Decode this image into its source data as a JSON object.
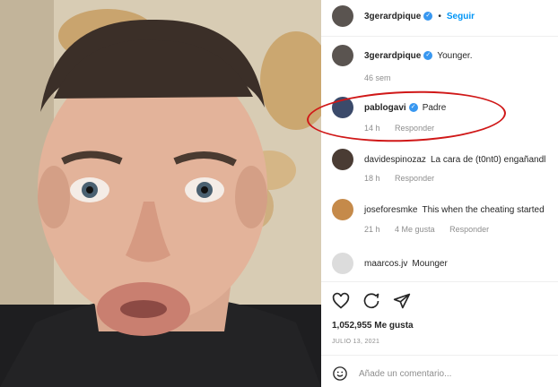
{
  "post": {
    "author": "3gerardpique",
    "follow_label": "Seguir",
    "dot": "•"
  },
  "caption": {
    "username": "3gerardpique",
    "text": "Younger.",
    "time": "46 sem"
  },
  "comments": [
    {
      "username": "pablogavi",
      "verified": true,
      "text": "Padre",
      "time": "14 h",
      "likes": "",
      "reply": "Responder"
    },
    {
      "username": "davidespinozaz",
      "verified": false,
      "text": "La cara de (t0nt0) engañandl",
      "time": "18 h",
      "likes": "",
      "reply": "Responder"
    },
    {
      "username": "joseforesmke",
      "verified": false,
      "text": "This when the cheating started",
      "time": "21 h",
      "likes": "4 Me gusta",
      "reply": "Responder"
    },
    {
      "username": "maarcos.jv",
      "verified": false,
      "text": "Mounger",
      "time": "",
      "likes": "",
      "reply": ""
    }
  ],
  "verified_glyph": "✓",
  "likes_count": "1,052,955 Me gusta",
  "date": "JULIO 13, 2021",
  "add_comment_placeholder": "Añade un comentario...",
  "icons": [
    "heart-icon",
    "comment-icon",
    "share-icon",
    "emoji-icon"
  ],
  "colors": {
    "verified": "#3897f0",
    "follow": "#0095f6",
    "highlight": "#d01818"
  }
}
